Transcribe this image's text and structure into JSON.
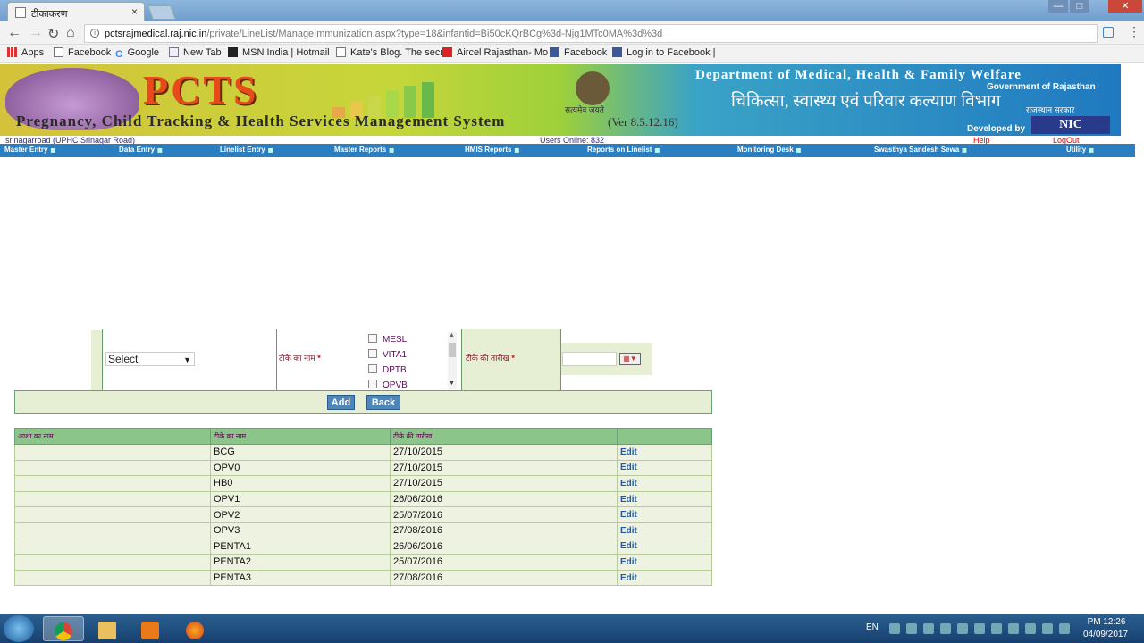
{
  "browser": {
    "tab_title": "टीकाकरण",
    "close_glyph": "×",
    "url_host": "pctsrajmedical.raj.nic.in",
    "url_path": "/private/LineList/ManageImmunization.aspx?type=18&infantid=Bi50cKQrBCg%3d-Njg1MTc0MA%3d%3d",
    "bookmarks": [
      "Apps",
      "Facebook",
      "Google",
      "New Tab",
      "MSN India | Hotmail",
      "Kate's Blog. The secr",
      "Aircel Rajasthan- Mo",
      "Facebook",
      "Log in to Facebook |"
    ]
  },
  "banner": {
    "logo_text": "PCTS",
    "subtitle": "Pregnancy, Child Tracking & Health Services Management System",
    "version": "(Ver 8.5.12.16)",
    "emblem_caption": "सत्यमेव जयते",
    "department": "Department of Medical, Health & Family Welfare",
    "government": "Government of Rajasthan",
    "department_hindi": "चिकित्सा, स्वास्थ्य एवं परिवार कल्याण विभाग",
    "raj_sarkar": "राजस्थान सरकार",
    "developed_by": "Developed by",
    "nic": "NIC"
  },
  "status": {
    "user_location": "srinagarroad (UPHC Srinagar Road)",
    "users_online": "Users Online: 832",
    "help": "Help",
    "logout": "LogOut"
  },
  "menu": [
    "Master Entry",
    "Data Entry",
    "Linelist Entry",
    "Master Reports",
    "HMIS Reports",
    "Reports on Linelist",
    "Monitoring Desk",
    "Swasthya Sandesh Sewa",
    "Utility"
  ],
  "form": {
    "select_value": "Select",
    "vaccine_name_label": "टीके का नाम",
    "required_mark": "*",
    "vaccine_options": [
      "MESL",
      "VITA1",
      "DPTB",
      "OPVB"
    ],
    "date_label": "टीके की तारीख",
    "add_label": "Add",
    "back_label": "Back"
  },
  "table": {
    "headers": [
      "आशा का नाम",
      "टीके का नाम",
      "टीके की तारीख",
      ""
    ],
    "edit_label": "Edit",
    "rows": [
      {
        "asha": "",
        "vaccine": "BCG",
        "date": "27/10/2015"
      },
      {
        "asha": "",
        "vaccine": "OPV0",
        "date": "27/10/2015"
      },
      {
        "asha": "",
        "vaccine": "HB0",
        "date": "27/10/2015"
      },
      {
        "asha": "",
        "vaccine": "OPV1",
        "date": "26/06/2016"
      },
      {
        "asha": "",
        "vaccine": "OPV2",
        "date": "25/07/2016"
      },
      {
        "asha": "",
        "vaccine": "OPV3",
        "date": "27/08/2016"
      },
      {
        "asha": "",
        "vaccine": "PENTA1",
        "date": "26/06/2016"
      },
      {
        "asha": "",
        "vaccine": "PENTA2",
        "date": "25/07/2016"
      },
      {
        "asha": "",
        "vaccine": "PENTA3",
        "date": "27/08/2016"
      }
    ]
  },
  "taskbar": {
    "language": "EN",
    "time": "PM 12:26",
    "date": "04/09/2017"
  },
  "colors": {
    "menu_bar": "#2b7fc0",
    "form_bg": "#e6eed4",
    "table_header": "#8cc58a",
    "edit_link": "#1a5ab0",
    "required": "#e00000"
  }
}
